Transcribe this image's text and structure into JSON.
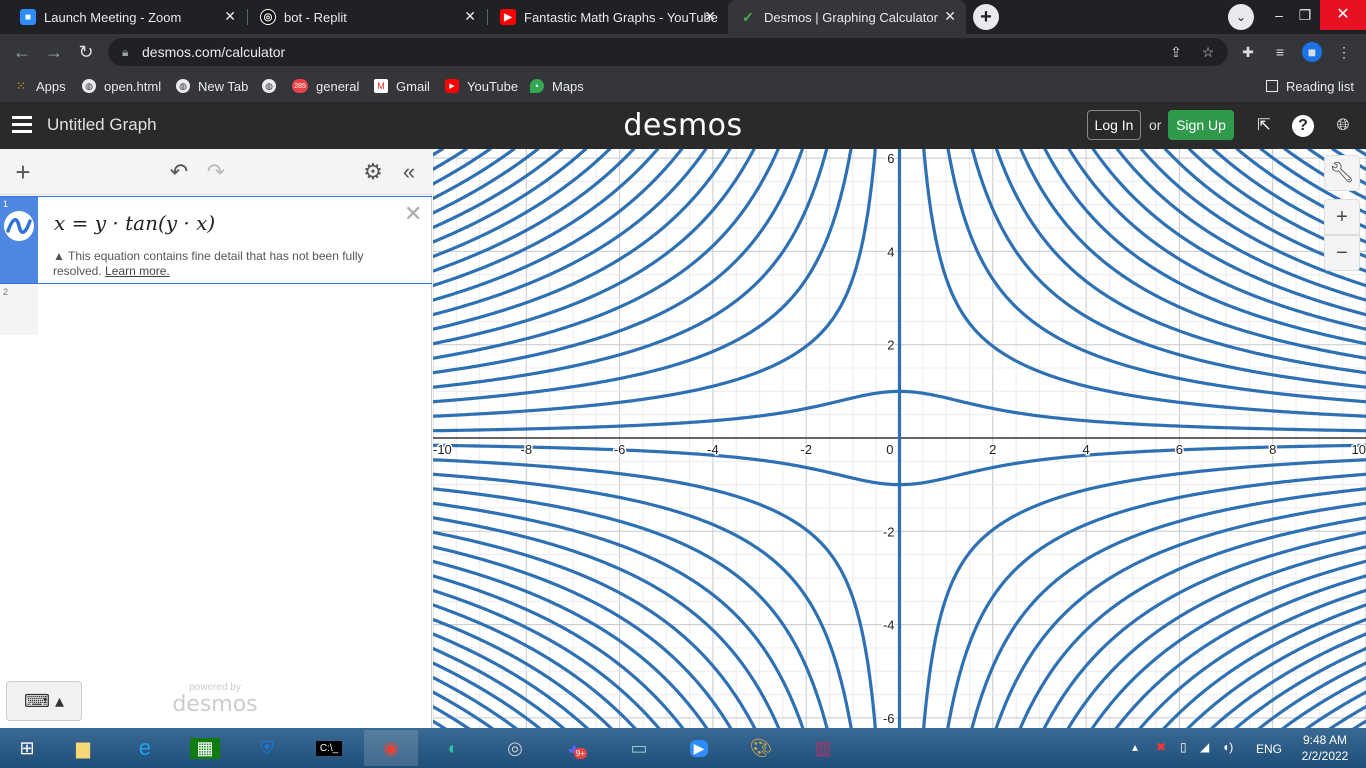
{
  "browser": {
    "tabs": [
      {
        "title": "Launch Meeting - Zoom",
        "icon": "zoom-icon",
        "color": "#2d8cff"
      },
      {
        "title": "bot - Replit",
        "icon": "replit-icon",
        "color": "#ffffff"
      },
      {
        "title": "Fantastic Math Graphs - YouTube",
        "icon": "youtube-icon",
        "color": "#ff0000"
      },
      {
        "title": "Desmos | Graphing Calculator",
        "icon": "desmos-icon",
        "color": "#4caf50"
      }
    ],
    "url": "desmos.com/calculator",
    "bookmarks": [
      {
        "label": "Apps",
        "icon": "apps-grid-icon"
      },
      {
        "label": "open.html",
        "icon": "globe-icon"
      },
      {
        "label": "New Tab",
        "icon": "globe-icon"
      },
      {
        "label": "",
        "icon": "globe-icon"
      },
      {
        "label": "general",
        "icon": "discord-badge-icon",
        "badge": "285"
      },
      {
        "label": "Gmail",
        "icon": "gmail-icon"
      },
      {
        "label": "YouTube",
        "icon": "youtube-icon"
      },
      {
        "label": "Maps",
        "icon": "maps-icon"
      }
    ],
    "reading_list": "Reading list"
  },
  "desmos": {
    "title": "Untitled Graph",
    "logo": "desmos",
    "login": "Log In",
    "or": "or",
    "signup": "Sign Up",
    "expressions": [
      {
        "number": "1",
        "formula": "x = y · tan(y · x)",
        "warning": "This equation contains fine detail that has not been fully resolved.",
        "learn_more": "Learn more.",
        "color": "#2f72dc"
      },
      {
        "number": "2",
        "formula": ""
      }
    ],
    "powered_by": "powered by",
    "powered_logo": "desmos"
  },
  "chart_data": {
    "type": "line",
    "title": "",
    "xlim": [
      -10,
      10
    ],
    "ylim": [
      -6,
      6
    ],
    "x_ticks": [
      "-10",
      "-8",
      "-6",
      "-4",
      "-2",
      "0",
      "2",
      "4",
      "6",
      "8",
      "10"
    ],
    "y_ticks": [
      "-6",
      "-4",
      "-2",
      "2",
      "4",
      "6"
    ],
    "grid": true,
    "series": [
      {
        "equation": "x = y·tan(y·x)",
        "color": "#2d70b3"
      }
    ]
  },
  "taskbar": {
    "apps": [
      "start-icon",
      "file-explorer-icon",
      "ie-icon",
      "store-icon",
      "defender-icon",
      "terminal-icon",
      "chrome-icon",
      "edge-icon",
      "speaker-app-icon",
      "discord-icon",
      "monitor-app-icon",
      "zoom-icon",
      "paint-icon",
      "winrar-icon"
    ],
    "discord_badge": "9+",
    "language": "ENG",
    "time": "9:48 AM",
    "date": "2/2/2022"
  }
}
